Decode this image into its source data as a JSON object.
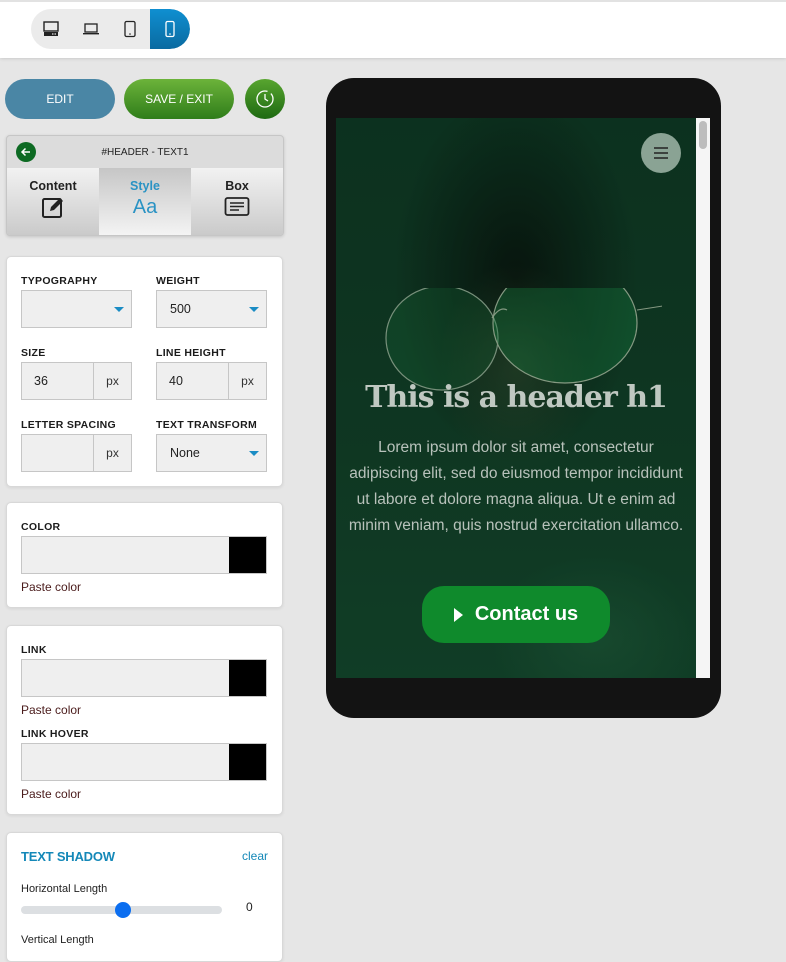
{
  "toolbar": {
    "devices": [
      {
        "name": "desktop",
        "icon": "desktop-icon",
        "active": false
      },
      {
        "name": "laptop",
        "icon": "laptop-icon",
        "active": false
      },
      {
        "name": "tablet",
        "icon": "tablet-icon",
        "active": false
      },
      {
        "name": "mobile",
        "icon": "mobile-icon",
        "active": true
      }
    ]
  },
  "actions": {
    "edit_label": "EDIT",
    "save_label": "SAVE / EXIT",
    "history_icon": "clock-icon"
  },
  "element_panel": {
    "title": "#HEADER - TEXT1",
    "tabs": [
      {
        "label": "Content",
        "icon": "edit-icon",
        "active": false
      },
      {
        "label": "Style",
        "icon_text": "Aa",
        "active": true
      },
      {
        "label": "Box",
        "icon": "box-text-icon",
        "active": false
      }
    ]
  },
  "typography": {
    "typography_label": "TYPOGRAPHY",
    "typography_value": "",
    "weight_label": "WEIGHT",
    "weight_value": "500",
    "size_label": "SIZE",
    "size_value": "36",
    "size_unit": "px",
    "line_height_label": "LINE HEIGHT",
    "line_height_value": "40",
    "line_height_unit": "px",
    "letter_spacing_label": "LETTER SPACING",
    "letter_spacing_value": "",
    "letter_spacing_unit": "px",
    "text_transform_label": "TEXT TRANSFORM",
    "text_transform_value": "None"
  },
  "color": {
    "label": "COLOR",
    "value": "#000000",
    "paste_label": "Paste color"
  },
  "link": {
    "label": "LINK",
    "value": "#000000",
    "paste_label": "Paste color",
    "hover_label": "LINK HOVER",
    "hover_value": "#000000",
    "hover_paste_label": "Paste color"
  },
  "text_shadow": {
    "title": "TEXT SHADOW",
    "clear_label": "clear",
    "horizontal_label": "Horizontal Length",
    "horizontal_value": "0",
    "vertical_label": "Vertical Length"
  },
  "preview": {
    "title": "This is a header h1",
    "body": "Lorem ipsum dolor sit amet, consectetur adipiscing elit, sed do eiusmod tempor incididunt ut labore et dolore magna aliqua. Ut e enim ad minim veniam, quis nostrud exercitation ullamco.",
    "cta_label": "Contact us",
    "menu_icon": "hamburger-icon"
  },
  "colors": {
    "accent_blue": "#1488b8",
    "save_green": "#2f7d1a",
    "cta_green": "#0f8a2c",
    "edit_blue": "#4a86a5"
  }
}
